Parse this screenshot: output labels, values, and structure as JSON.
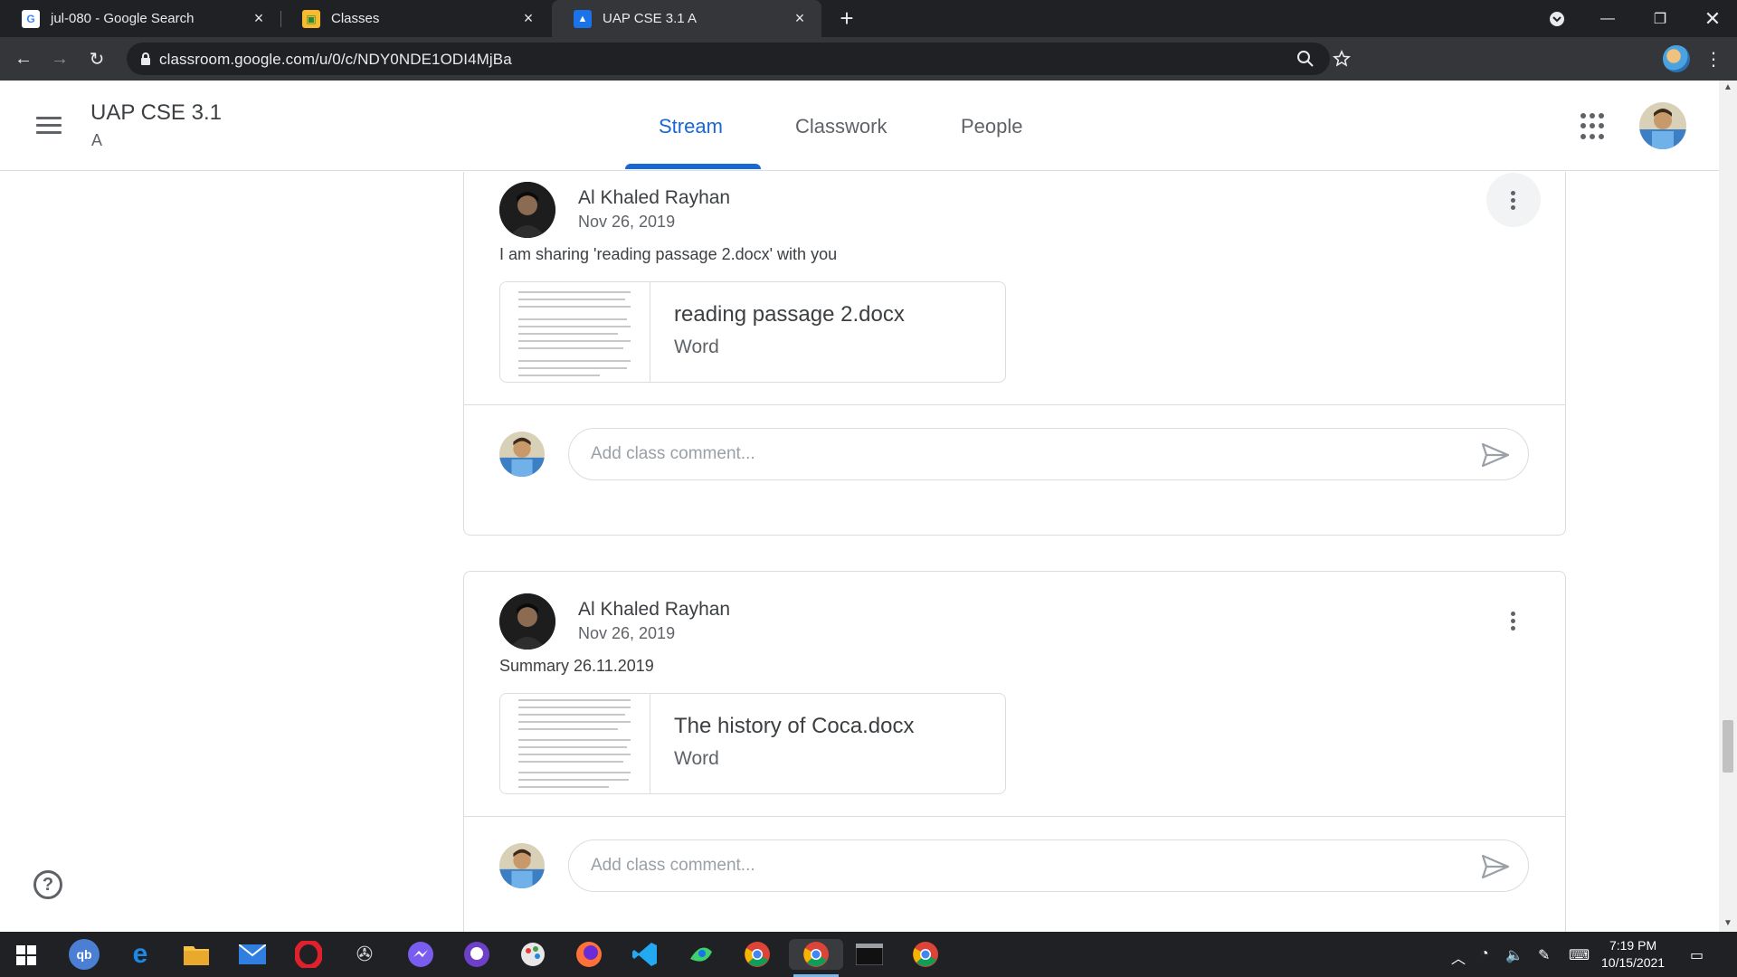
{
  "browser": {
    "tabs": [
      {
        "title": "jul-080 - Google Search",
        "favicon": "google-icon"
      },
      {
        "title": "Classes",
        "favicon": "classroom-icon"
      },
      {
        "title": "UAP CSE 3.1 A",
        "favicon": "classroom-class-icon",
        "active": true
      }
    ],
    "url": "classroom.google.com/u/0/c/NDY0NDE1ODI4MjBa"
  },
  "app": {
    "class_name": "UAP CSE 3.1",
    "section": "A",
    "nav_tabs": [
      {
        "label": "Stream",
        "active": true
      },
      {
        "label": "Classwork"
      },
      {
        "label": "People"
      }
    ],
    "accent_color": "#1967d2"
  },
  "posts": [
    {
      "author": "Al Khaled Rayhan",
      "date": "Nov 26, 2019",
      "text": "I am sharing 'reading passage 2.docx' with you",
      "attachment": {
        "title": "reading passage 2.docx",
        "type": "Word"
      },
      "comment_placeholder": "Add class comment..."
    },
    {
      "author": "Al Khaled Rayhan",
      "date": "Nov 26, 2019",
      "text": "Summary 26.11.2019",
      "attachment": {
        "title": "The history of Coca.docx",
        "type": "Word"
      },
      "comment_placeholder": "Add class comment..."
    }
  ],
  "taskbar": {
    "time": "7:19 PM",
    "date": "10/15/2021"
  }
}
